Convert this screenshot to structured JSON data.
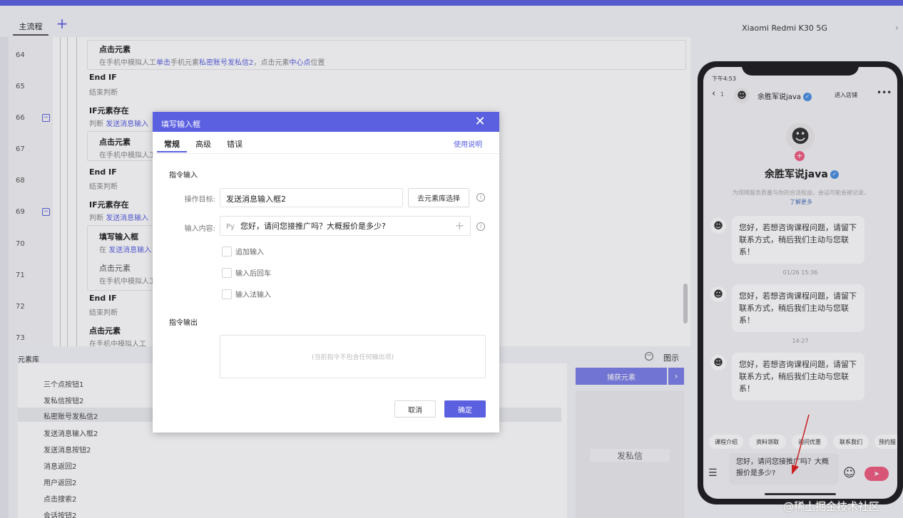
{
  "tabs": {
    "main": "主流程",
    "add": "+"
  },
  "flow": {
    "rows": [
      {
        "no": "64",
        "title": "点击元素",
        "desc_parts": [
          "在手机中模拟人工",
          "单击",
          "手机元素",
          "私密账号发私信2",
          "，点击元素",
          "中心点",
          "位置"
        ]
      },
      {
        "no": "65",
        "title": "End IF",
        "desc": "结束判断"
      },
      {
        "no": "66",
        "title": "IF元素存在",
        "desc_prefix": "判断",
        "desc_hl": "发送消息输入"
      },
      {
        "no": "67",
        "title": "点击元素",
        "desc": "在手机中模拟人工"
      },
      {
        "no": "68",
        "title": "End IF",
        "desc": "结束判断"
      },
      {
        "no": "69",
        "title": "IF元素存在",
        "desc_prefix": "判断",
        "desc_hl": "发送消息输入"
      },
      {
        "no": "70",
        "title": "填写输入框",
        "desc_prefix": "在",
        "desc_hl": "发送消息输入"
      },
      {
        "no": "71",
        "title": "点击元素",
        "desc": "在手机中模拟人工"
      },
      {
        "no": "72",
        "title": "End IF",
        "desc": "结束判断"
      },
      {
        "no": "73",
        "title": "点击元素",
        "desc": "在手机中模拟人工"
      }
    ]
  },
  "library": {
    "title": "元素库",
    "diagram_label": "图示",
    "items": [
      "三个点按钮1",
      "发私信按钮2",
      "私密账号发私信2",
      "发送消息输入框2",
      "发送消息按钮2",
      "消息返回2",
      "用户返回2",
      "点击搜索2",
      "会话按钮2"
    ],
    "capture_btn": "捕获元素",
    "preview_label": "发私信"
  },
  "device": {
    "name": "Xiaomi Redmi K30 5G"
  },
  "phone": {
    "status_time": "下午4:53",
    "back_count": "1",
    "header_name": "余胜军说java",
    "enter_shop": "进入店铺",
    "profile_name": "余胜军说java",
    "notice": "为保障服务质量与你的合法权益，会话可能会被记录，",
    "notice_link": "了解更多",
    "message": "您好，若想咨询课程问题，请留下联系方式，稍后我们主动与您联系！",
    "timestamps": [
      "01/26 15:36",
      "14:27"
    ],
    "quick_replies": [
      "课程介绍",
      "资料领取",
      "询问优惠",
      "联系我们",
      "预约服"
    ],
    "input_text": "您好，请问您接推广吗？大概报价是多少?"
  },
  "dialog": {
    "title": "填写输入框",
    "tabs": [
      "常规",
      "高级",
      "错误"
    ],
    "help": "使用说明",
    "input_section": "指令输入",
    "target_label": "操作目标:",
    "target_value": "发送消息输入框2",
    "choose_btn": "去元素库选择",
    "content_label": "输入内容:",
    "content_prefix": "Py",
    "content_value": "您好，请问您接推广吗？大概报价是多少?",
    "options": [
      "追加输入",
      "输入后回车",
      "输入法输入"
    ],
    "output_section": "指令输出",
    "output_empty": "(当前指令不包含任何输出项)",
    "cancel": "取消",
    "ok": "确定"
  },
  "watermark": "@稀土掘金技术社区"
}
